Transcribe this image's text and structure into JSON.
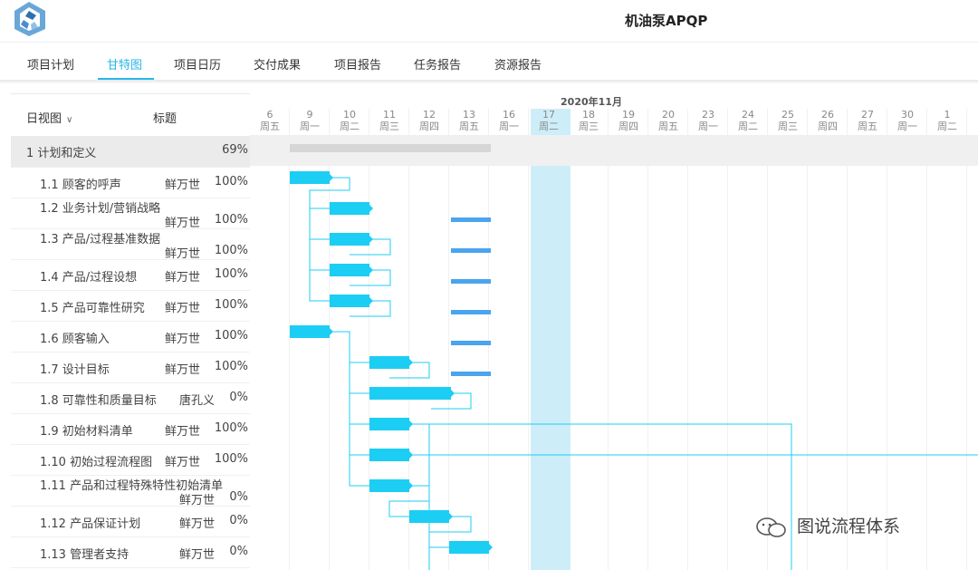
{
  "app": {
    "title": "机油泵APQP"
  },
  "tabs": [
    {
      "label": "项目计划",
      "active": false
    },
    {
      "label": "甘特图",
      "active": true
    },
    {
      "label": "项目日历",
      "active": false
    },
    {
      "label": "交付成果",
      "active": false
    },
    {
      "label": "项目报告",
      "active": false
    },
    {
      "label": "任务报告",
      "active": false
    },
    {
      "label": "资源报告",
      "active": false
    }
  ],
  "left_panel": {
    "view_label": "日视图",
    "title_header": "标题"
  },
  "tasks": [
    {
      "name": "1 计划和定义",
      "owner": "",
      "progress": "69%"
    },
    {
      "name": "1.1 顾客的呼声",
      "owner": "鲜万世",
      "progress": "100%"
    },
    {
      "name": "1.2 业务计划/营销战略",
      "owner": "鲜万世",
      "progress": "100%"
    },
    {
      "name": "1.3 产品/过程基准数据",
      "owner": "鲜万世",
      "progress": "100%"
    },
    {
      "name": "1.4 产品/过程设想",
      "owner": "鲜万世",
      "progress": "100%"
    },
    {
      "name": "1.5 产品可靠性研究",
      "owner": "鲜万世",
      "progress": "100%"
    },
    {
      "name": "1.6 顾客输入",
      "owner": "鲜万世",
      "progress": "100%"
    },
    {
      "name": "1.7 设计目标",
      "owner": "鲜万世",
      "progress": "100%"
    },
    {
      "name": "1.8 可靠性和质量目标",
      "owner": "唐孔义",
      "progress": "0%"
    },
    {
      "name": "1.9 初始材料清单",
      "owner": "鲜万世",
      "progress": "100%"
    },
    {
      "name": "1.10 初始过程流程图",
      "owner": "鲜万世",
      "progress": "100%"
    },
    {
      "name": "1.11 产品和过程特殊特性初始清单",
      "owner": "鲜万世",
      "progress": "0%"
    },
    {
      "name": "1.12 产品保证计划",
      "owner": "鲜万世",
      "progress": "0%"
    },
    {
      "name": "1.13 管理者支持",
      "owner": "鲜万世",
      "progress": "0%"
    }
  ],
  "timeline": {
    "month": "2020年11月",
    "days": [
      {
        "d": "6",
        "w": "周五"
      },
      {
        "d": "9",
        "w": "周一"
      },
      {
        "d": "10",
        "w": "周二"
      },
      {
        "d": "11",
        "w": "周三"
      },
      {
        "d": "12",
        "w": "周四"
      },
      {
        "d": "13",
        "w": "周五"
      },
      {
        "d": "16",
        "w": "周一"
      },
      {
        "d": "17",
        "w": "周二"
      },
      {
        "d": "18",
        "w": "周三"
      },
      {
        "d": "19",
        "w": "周四"
      },
      {
        "d": "20",
        "w": "周五"
      },
      {
        "d": "23",
        "w": "周一"
      },
      {
        "d": "24",
        "w": "周二"
      },
      {
        "d": "25",
        "w": "周三"
      },
      {
        "d": "26",
        "w": "周四"
      },
      {
        "d": "27",
        "w": "周五"
      },
      {
        "d": "30",
        "w": "周一"
      },
      {
        "d": "1",
        "w": "周二"
      }
    ],
    "today_index": 7
  },
  "watermark": {
    "text": "图说流程体系"
  },
  "colors": {
    "accent": "#2ab6e6",
    "bar": "#1ccdf4",
    "today": "#cdeef8",
    "baseline": "#4aa4ee"
  }
}
